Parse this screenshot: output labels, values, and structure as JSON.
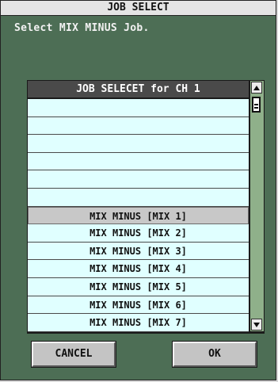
{
  "dialog": {
    "title": "JOB SELECT",
    "prompt": "Select MIX MINUS Job."
  },
  "list": {
    "header": "JOB SELECET for CH 1",
    "items": [
      "",
      "",
      "",
      "",
      "",
      "",
      "MIX MINUS [MIX 1]",
      "MIX MINUS [MIX 2]",
      "MIX MINUS [MIX 3]",
      "MIX MINUS [MIX 4]",
      "MIX MINUS [MIX 5]",
      "MIX MINUS [MIX 6]",
      "MIX MINUS [MIX 7]"
    ],
    "selected_index": 6
  },
  "buttons": {
    "cancel": "CANCEL",
    "ok": "OK"
  },
  "colors": {
    "dialog_bg": "#4d6e55",
    "row_bg": "#e0ffff",
    "selected_row_bg": "#c8c8c8",
    "header_bg": "#4a4a4a",
    "scrollbar_bg": "#8fb08a"
  }
}
